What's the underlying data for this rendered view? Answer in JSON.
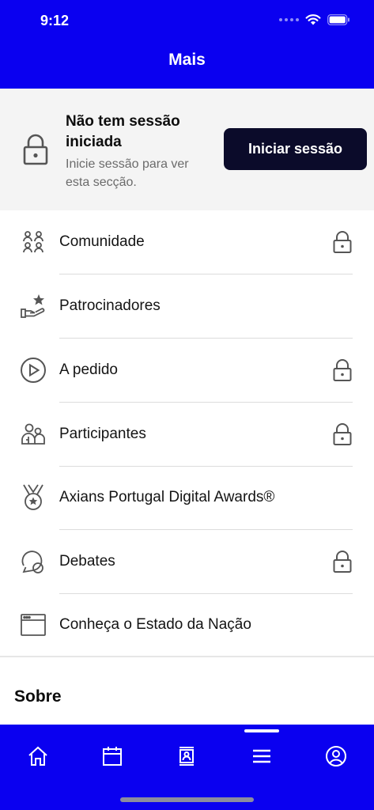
{
  "status": {
    "time": "9:12"
  },
  "header": {
    "title": "Mais"
  },
  "login": {
    "title": "Não tem sessão iniciada",
    "subtitle": "Inicie sessão para ver esta secção.",
    "button_label": "Iniciar sessão"
  },
  "menu": {
    "items": [
      {
        "label": "Comunidade",
        "icon": "community-icon",
        "locked": true
      },
      {
        "label": "Patrocinadores",
        "icon": "sponsor-icon",
        "locked": false
      },
      {
        "label": "A pedido",
        "icon": "play-icon",
        "locked": true
      },
      {
        "label": "Participantes",
        "icon": "participants-icon",
        "locked": true
      },
      {
        "label": "Axians Portugal Digital Awards®",
        "icon": "medal-icon",
        "locked": false
      },
      {
        "label": "Debates",
        "icon": "chat-icon",
        "locked": true
      },
      {
        "label": "Conheça o Estado da Nação",
        "icon": "browser-window-icon",
        "locked": false
      }
    ]
  },
  "section": {
    "title": "Sobre"
  },
  "tabbar": {
    "tabs": [
      {
        "icon": "home-icon"
      },
      {
        "icon": "calendar-icon"
      },
      {
        "icon": "badge-icon"
      },
      {
        "icon": "menu-icon",
        "active": true
      },
      {
        "icon": "profile-icon"
      }
    ]
  },
  "colors": {
    "brand": "#0a00f0",
    "button": "#0b0b2a",
    "card_bg": "#f4f4f4"
  }
}
